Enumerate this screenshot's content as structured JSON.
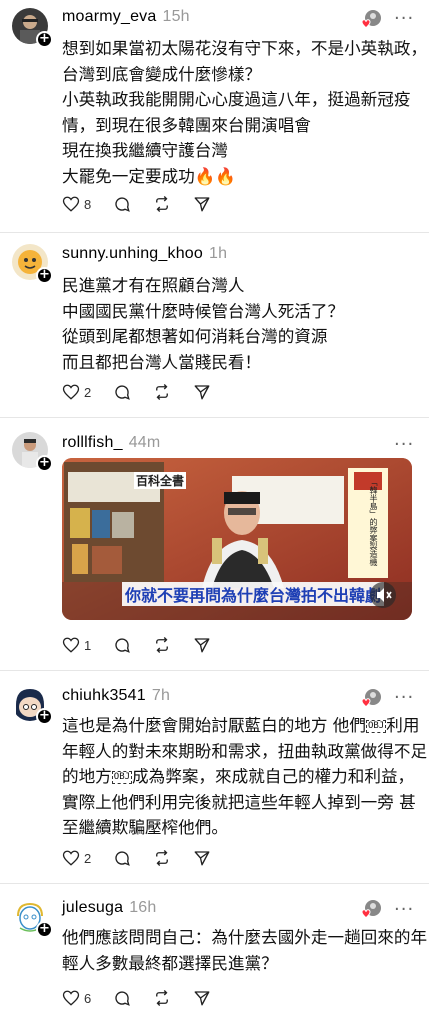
{
  "posts": [
    {
      "username": "moarmy_eva",
      "time": "15h",
      "lines": [
        "想到如果當初太陽花沒有守下來，不是小英執政，",
        "台灣到底會變成什麼慘樣？",
        "小英執政我能開開心心度過這八年，挺過新冠疫",
        "情，到現在很多韓團來台開演唱會",
        "現在換我繼續守護台灣",
        "大罷免一定要成功🔥🔥"
      ],
      "likes": "8",
      "liked_by_icon": "user-avatar-heart"
    },
    {
      "username": "sunny.unhing_khoo",
      "time": "1h",
      "lines": [
        "民進黨才有在照顧台灣人",
        "中國國民黨什麼時候管台灣人死活了？",
        "從頭到尾都想著如何消耗台灣的資源",
        "而且都把台灣人當賤民看！"
      ],
      "likes": "2"
    },
    {
      "username": "rolllfish_",
      "time": "44m",
      "video": {
        "caption": "你就不要再問為什麼台灣拍不出韓劇",
        "book_label": "百科全書",
        "side_label": "「韓半島」的弊案製造機"
      },
      "likes": "1"
    },
    {
      "username": "chiuhk3541",
      "time": "7h",
      "lines_rich": [
        {
          "a": "這也是為什麼會開始討厭藍白的地方 他們",
          "obj": "OBJ",
          "b": "利用"
        },
        {
          "a": "年輕人的對未來期盼和需求，扭曲執政黨做得不足",
          "obj": "",
          "b": ""
        },
        {
          "a": "的地方",
          "obj": "OBJ",
          "b": "成為弊案，來成就自己的權力和利益，"
        },
        {
          "a": "實際上他們利用完後就把這些年輕人掉到一旁 甚",
          "obj": "",
          "b": ""
        },
        {
          "a": "至繼續欺騙壓榨他們。",
          "obj": "",
          "b": ""
        }
      ],
      "likes": "2"
    },
    {
      "username": "julesuga",
      "time": "16h",
      "lines": [
        "他們應該問問自己：為什麼去國外走一趟回來的年",
        "輕人多數最終都選擇民進黨？"
      ],
      "likes": "6"
    }
  ],
  "colors": {
    "accent_red": "#ff3040",
    "divider": "#e6e6e6",
    "muted": "#999999"
  }
}
